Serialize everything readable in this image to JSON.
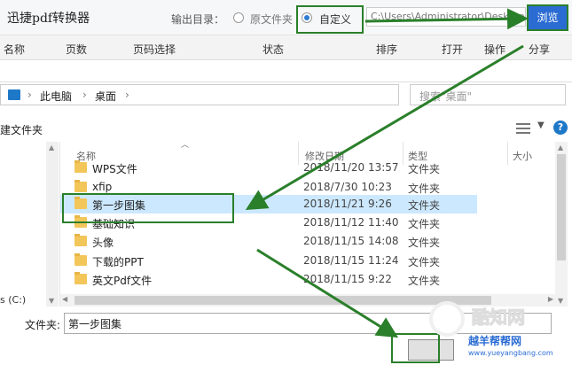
{
  "app": {
    "title": "迅捷pdf转换器",
    "output_dir_label": "输出目录：",
    "option_source": "原文件夹",
    "option_custom": "自定义",
    "path_value": "C:\\Users\\Administrator\\Desktop",
    "browse_label": "浏览"
  },
  "columns": {
    "name": "名称",
    "pages": "页数",
    "page_select": "页码选择",
    "status": "状态",
    "sort": "排序",
    "open": "打开",
    "operate": "操作",
    "share": "分享"
  },
  "address": {
    "pc": "此电脑",
    "desktop": "桌面",
    "search_placeholder": "搜索\"桌面\""
  },
  "toolbar": {
    "new_folder": "建文件夹"
  },
  "list": {
    "headers": {
      "name": "名称",
      "modified": "修改日期",
      "type": "类型",
      "size": "大小"
    },
    "rows": [
      {
        "name": "WPS文件",
        "date": "2018/11/20 13:57",
        "type": "文件夹"
      },
      {
        "name": "xfip",
        "date": "2018/7/30 10:23",
        "type": "文件夹"
      },
      {
        "name": "第一步图集",
        "date": "2018/11/21 9:26",
        "type": "文件夹",
        "selected": true
      },
      {
        "name": "基础知识",
        "date": "2018/11/12 11:40",
        "type": "文件夹"
      },
      {
        "name": "头像",
        "date": "2018/11/15 14:08",
        "type": "文件夹"
      },
      {
        "name": "下载的PPT",
        "date": "2018/11/15 11:24",
        "type": "文件夹"
      },
      {
        "name": "英文Pdf文件",
        "date": "2018/11/15 9:22",
        "type": "文件夹"
      }
    ]
  },
  "nav": {
    "drive": "s (C:)"
  },
  "footer": {
    "folder_label": "文件夹:",
    "folder_value": "第一步图集"
  },
  "watermark": {
    "brand": "酷知网",
    "sub": "越羊帮帮网",
    "url": "www.yueyangbang.com"
  },
  "colors": {
    "accent": "#2b6cd3",
    "highlight_green": "#2a7f2a",
    "selected_row": "#cce8ff"
  }
}
